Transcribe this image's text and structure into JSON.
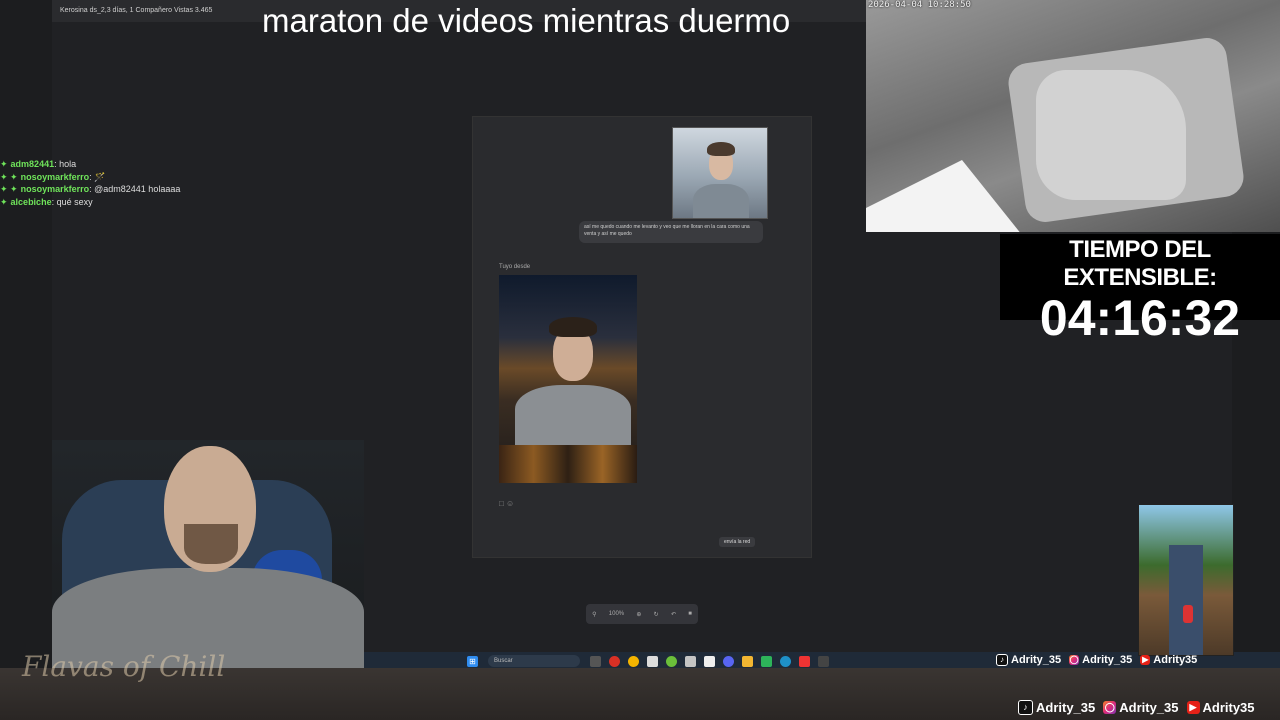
{
  "stream_title": "maraton de videos mientras duermo",
  "desktop": {
    "topbar_text": "Kerosina ds_2,3 días, 1 Compañero Vistas 3.465"
  },
  "chat_window": {
    "message_text": "así me quedo cuando me levanto y veo que me lloran en la cara como una venta y así me quedo",
    "sender_label": "Tuyo desde",
    "reply_chip": "envía la red"
  },
  "bottom_toolbar": {
    "zoom": "100%"
  },
  "taskbar": {
    "search_placeholder": "Buscar"
  },
  "bedroom_cam": {
    "timestamp": "2026-04-04 10:28:50"
  },
  "timer": {
    "label": "TIEMPO DEL EXTENSIBLE:",
    "value": "04:16:32"
  },
  "chat": [
    {
      "user": "adm82441",
      "message": "hola",
      "emote": ""
    },
    {
      "user": "nosoymarkferro",
      "message": "",
      "emote": "🪄"
    },
    {
      "user": "nosoymarkferro",
      "message": "@adm82441 holaaaa",
      "emote": ""
    },
    {
      "user": "alcebiche",
      "message": "qué sexy",
      "emote": ""
    }
  ],
  "brand_script": "Flavas of Chill",
  "socials_top": [
    "Adrity_35",
    "Adrity_35",
    "Adrity35"
  ],
  "socials_bottom": [
    "Adrity_35",
    "Adrity_35",
    "Adrity35"
  ],
  "colors": {
    "chat_user": "#6fe35a",
    "timer_bg": "#000000",
    "taskbar": "#1f2a38"
  }
}
